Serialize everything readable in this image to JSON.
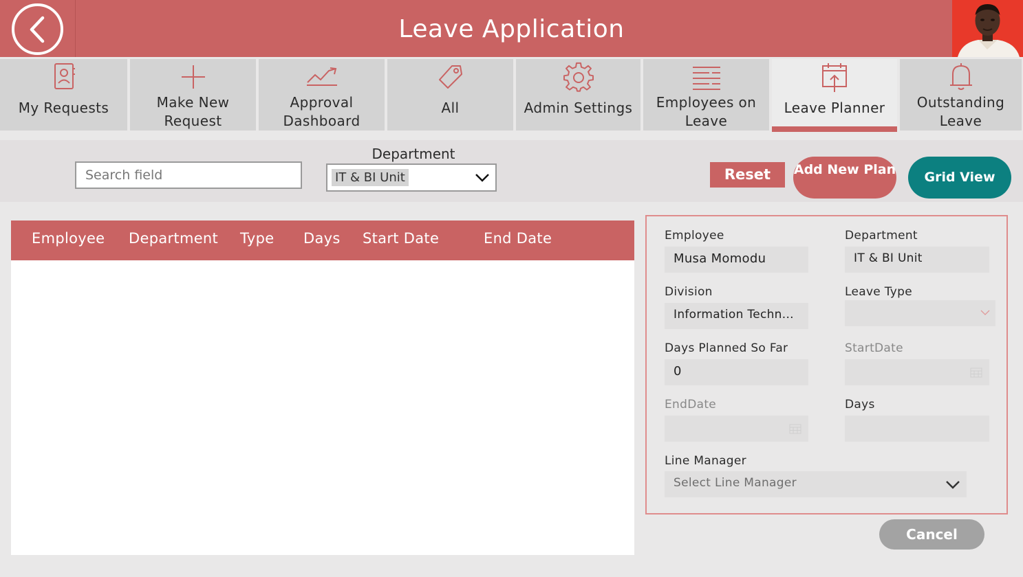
{
  "header": {
    "title": "Leave Application",
    "back_icon": "chevron-left-icon",
    "avatar_icon": "user-photo"
  },
  "nav": {
    "tabs": [
      {
        "label": "My Requests",
        "icon": "contact-book-icon"
      },
      {
        "label": "Make New Request",
        "icon": "plus-icon"
      },
      {
        "label": "Approval Dashboard",
        "icon": "trend-chart-icon"
      },
      {
        "label": "All",
        "icon": "tag-icon"
      },
      {
        "label": "Admin Settings",
        "icon": "gear-icon"
      },
      {
        "label": "Employees on Leave",
        "icon": "list-icon"
      },
      {
        "label": "Leave Planner",
        "icon": "calendar-upload-icon",
        "active": true
      },
      {
        "label": "Outstanding Leave",
        "icon": "bell-icon"
      }
    ]
  },
  "filters": {
    "search_placeholder": "Search field",
    "department_label": "Department",
    "department_value": "IT & BI Unit",
    "reset_label": "Reset",
    "add_plan_label": "Add New Plan",
    "grid_view_label": "Grid View"
  },
  "table": {
    "columns": [
      "Employee",
      "Department",
      "Type",
      "Days",
      "Start Date",
      "End Date"
    ],
    "rows": []
  },
  "form": {
    "employee_label": "Employee",
    "employee_value": "Musa Momodu",
    "department_label": "Department",
    "department_value": "IT & BI Unit",
    "division_label": "Division",
    "division_value": "Information Techn...",
    "leave_type_label": "Leave Type",
    "leave_type_value": "",
    "days_planned_label": "Days Planned So Far",
    "days_planned_value": "0",
    "start_date_label": "StartDate",
    "start_date_value": "",
    "end_date_label": "EndDate",
    "end_date_value": "",
    "days_label": "Days",
    "days_value": "",
    "line_manager_label": "Line Manager",
    "line_manager_placeholder": "Select Line Manager",
    "cancel_label": "Cancel"
  },
  "colors": {
    "primary": "#c96363",
    "teal": "#0c8080",
    "tab_bg": "#d3d3d3",
    "page_bg": "#e9e8e8"
  }
}
